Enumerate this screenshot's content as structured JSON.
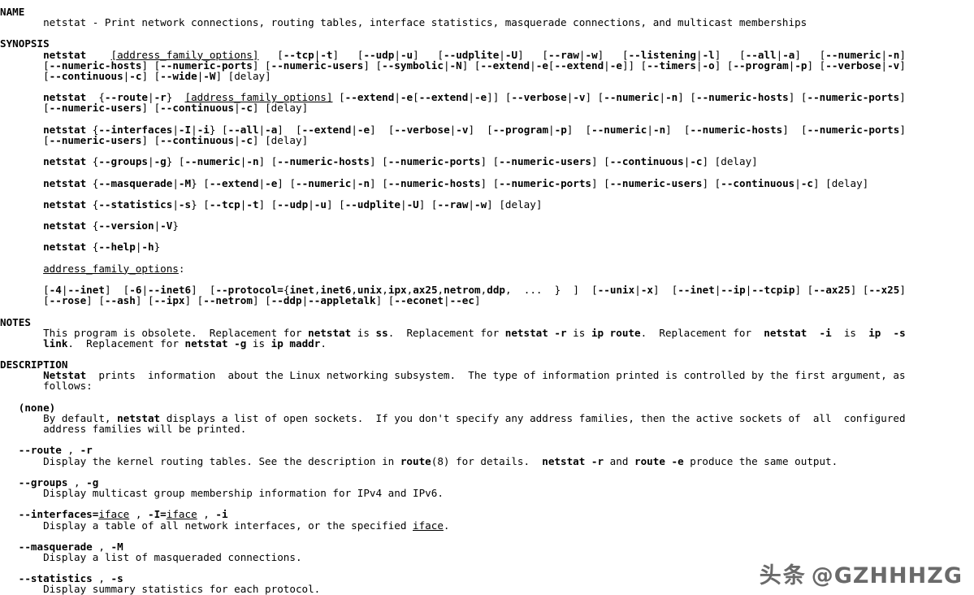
{
  "document": {
    "kind": "man-page",
    "command": "netstat",
    "sections": [
      {
        "id": "name",
        "heading": "NAME",
        "body": "     netstat - Print network connections, routing tables, interface statistics, masquerade connections, and multicast memberships"
      },
      {
        "id": "synopsis",
        "heading": "SYNOPSIS",
        "lines": [
          "     netstat    [address_family_options]   [--tcp|-t]   [--udp|-u]   [--udplite|-U]   [--raw|-w]   [--listening|-l]   [--all|-a]   [--numeric|-n]",
          "     [--numeric-hosts] [--numeric-ports] [--numeric-users] [--symbolic|-N] [--extend|-e[--extend|-e]] [--timers|-o] [--program|-p] [--verbose|-v]",
          "     [--continuous|-c] [--wide|-W] [delay]",
          "",
          "     netstat  {--route|-r}  [address_family_options] [--extend|-e[--extend|-e]] [--verbose|-v] [--numeric|-n] [--numeric-hosts] [--numeric-ports]",
          "     [--numeric-users] [--continuous|-c] [delay]",
          "",
          "     netstat {--interfaces|-I|-i} [--all|-a]  [--extend|-e]  [--verbose|-v]  [--program|-p]  [--numeric|-n]  [--numeric-hosts]  [--numeric-ports]",
          "     [--numeric-users] [--continuous|-c] [delay]",
          "",
          "     netstat {--groups|-g} [--numeric|-n] [--numeric-hosts] [--numeric-ports] [--numeric-users] [--continuous|-c] [delay]",
          "",
          "     netstat {--masquerade|-M} [--extend|-e] [--numeric|-n] [--numeric-hosts] [--numeric-ports] [--numeric-users] [--continuous|-c] [delay]",
          "",
          "     netstat {--statistics|-s} [--tcp|-t] [--udp|-u] [--udplite|-U] [--raw|-w] [delay]",
          "",
          "     netstat {--version|-V}",
          "",
          "     netstat {--help|-h}",
          "",
          "     address_family_options:",
          "",
          "     [-4|--inet]  [-6|--inet6]  [--protocol={inet,inet6,unix,ipx,ax25,netrom,ddp,  ...  }  ]  [--unix|-x]  [--inet|--ip|--tcpip] [--ax25] [--x25]",
          "     [--rose] [--ash] [--ipx] [--netrom] [--ddp|--appletalk] [--econet|--ec]"
        ]
      },
      {
        "id": "notes",
        "heading": "NOTES",
        "lines": [
          "     This program is obsolete.  Replacement for netstat is ss.  Replacement for netstat -r is ip route.  Replacement for  netstat  -i  is  ip  -s",
          "     link.  Replacement for netstat -g is ip maddr."
        ]
      },
      {
        "id": "description",
        "heading": "DESCRIPTION",
        "lines": [
          "     Netstat  prints  information  about the Linux networking subsystem.  The type of information printed is controlled by the first argument, as",
          "     follows:"
        ],
        "items": [
          {
            "term": "(none)",
            "body": [
              "     By default, netstat displays a list of open sockets.  If you don't specify any address families, then the active sockets of  all  configured",
              "     address families will be printed."
            ]
          },
          {
            "term": "--route , -r",
            "body": [
              "     Display the kernel routing tables. See the description in route(8) for details.  netstat -r and route -e produce the same output."
            ]
          },
          {
            "term": "--groups , -g",
            "body": [
              "     Display multicast group membership information for IPv4 and IPv6."
            ]
          },
          {
            "term": "--interfaces=iface , -I=iface , -i",
            "body": [
              "     Display a table of all network interfaces, or the specified iface."
            ]
          },
          {
            "term": "--masquerade , -M",
            "body": [
              "     Display a list of masqueraded connections."
            ]
          },
          {
            "term": "--statistics , -s",
            "body": [
              "     Display summary statistics for each protocol."
            ]
          }
        ]
      }
    ]
  },
  "watermark": {
    "cjk": "头条",
    "handle": "@GZHHHZG"
  }
}
